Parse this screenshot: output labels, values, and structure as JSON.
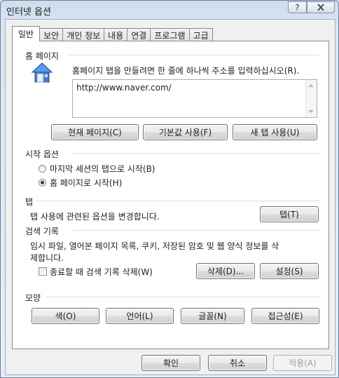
{
  "window": {
    "title": "인터넷 옵션",
    "help_glyph": "?",
    "close_icon": "close-icon"
  },
  "tabs": [
    {
      "label": "일반",
      "active": true
    },
    {
      "label": "보안"
    },
    {
      "label": "개인 정보"
    },
    {
      "label": "내용"
    },
    {
      "label": "연결"
    },
    {
      "label": "프로그램"
    },
    {
      "label": "고급"
    }
  ],
  "home_page": {
    "heading": "홈 페이지",
    "instruction": "홈페이지 탭을 만들려면 한 줄에 하나씩 주소를 입력하십시오(R).",
    "url_value": "http://www.naver.com/",
    "buttons": {
      "current": "현재 페이지(C)",
      "default": "기본값 사용(F)",
      "new_tab": "새 탭 사용(U)"
    }
  },
  "startup": {
    "heading": "시작 옵션",
    "options": [
      {
        "label": "마지막 세션의 탭으로 시작(B)",
        "selected": false
      },
      {
        "label": "홈 페이지로 시작(H)",
        "selected": true
      }
    ]
  },
  "tabs_group": {
    "heading": "탭",
    "description": "탭 사용에 관련된 옵션을 변경합니다.",
    "button": "탭(T)"
  },
  "history": {
    "heading": "검색 기록",
    "description_line1": "임시 파일, 열어본 페이지 목록, 쿠키, 저장된 암호 및 웹 양식 정보를 삭",
    "description_line2": "제합니다.",
    "checkbox_label": "종료할 때 검색 기록 삭제(W)",
    "checkbox_checked": false,
    "delete_button": "삭제(D)...",
    "settings_button": "설정(S)"
  },
  "appearance": {
    "heading": "모양",
    "buttons": {
      "colors": "색(O)",
      "languages": "언어(L)",
      "fonts": "글꼴(N)",
      "accessibility": "접근성(E)"
    }
  },
  "footer": {
    "ok": "확인",
    "cancel": "취소",
    "apply": "적용(A)"
  }
}
